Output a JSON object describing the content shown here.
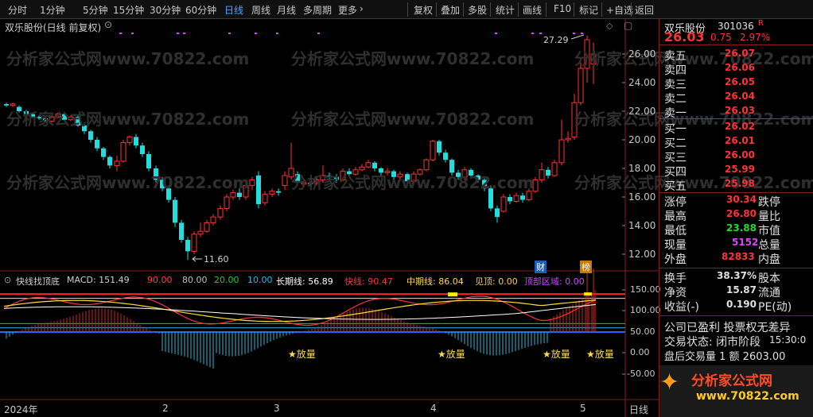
{
  "toolbar": {
    "left": [
      "分时",
      "1分钟",
      "5分钟",
      "15分钟",
      "30分钟",
      "60分钟",
      "日线",
      "周线",
      "月线",
      "多周期",
      "更多"
    ],
    "right": [
      "复权",
      "叠加",
      "多股",
      "统计",
      "画线",
      "F10",
      "标记",
      "+自选",
      "返回"
    ],
    "active": "日线"
  },
  "chart": {
    "title": "双乐股份(日线 前复权)",
    "watermark": "分析家公式网www.70822.com",
    "price_axis": [
      "26.00",
      "24.00",
      "22.00",
      "20.00",
      "18.00",
      "16.00",
      "14.00",
      "12.00"
    ],
    "high_label": "27.29",
    "low_label": "11.60",
    "badges": [
      "财",
      "榜"
    ],
    "date_axis": [
      "2024年",
      "2",
      "3",
      "4",
      "5"
    ],
    "date_right": "日线"
  },
  "indicator": {
    "name": "快线找顶底",
    "macd": "MACD: 151.49",
    "vals": [
      "90.00",
      "80.00",
      "20.00",
      "10.00"
    ],
    "long": "长期线: 56.89",
    "fast": "快线: 90.47",
    "mid": "中期线: 86.04",
    "top": "见顶: 0.00",
    "zone": "顶部区域: 0.00",
    "axis": [
      "150.00",
      "100.00",
      "50.00",
      "0.00",
      "-50.00"
    ],
    "signal": "放量"
  },
  "panel": {
    "name": "双乐股份",
    "code": "301036",
    "tag": "R",
    "price": "26.03",
    "change": "0.75",
    "pct": "2.97%",
    "sell": [
      {
        "label": "卖五",
        "price": "26.07"
      },
      {
        "label": "卖四",
        "price": "26.06"
      },
      {
        "label": "卖三",
        "price": "26.05"
      },
      {
        "label": "卖二",
        "price": "26.04"
      },
      {
        "label": "卖一",
        "price": "26.03"
      }
    ],
    "buy": [
      {
        "label": "买一",
        "price": "26.02"
      },
      {
        "label": "买二",
        "price": "26.01"
      },
      {
        "label": "买三",
        "price": "26.00"
      },
      {
        "label": "买四",
        "price": "25.99"
      },
      {
        "label": "买五",
        "price": "25.98"
      }
    ],
    "stats": [
      {
        "label": "涨停",
        "value": "30.34",
        "label2": "跌停",
        "color": "red"
      },
      {
        "label": "最高",
        "value": "26.80",
        "label2": "量比",
        "color": "red"
      },
      {
        "label": "最低",
        "value": "23.88",
        "label2": "市值",
        "color": "green"
      },
      {
        "label": "现量",
        "value": "5152",
        "label2": "总量",
        "color": "magenta"
      },
      {
        "label": "外盘",
        "value": "82833",
        "label2": "内盘",
        "color": "red"
      }
    ],
    "stats2": [
      {
        "label": "换手",
        "value": "38.37%",
        "label2": "股本"
      },
      {
        "label": "净资",
        "value": "15.87",
        "label2": "流通"
      },
      {
        "label": "收益(-)",
        "value": "0.190",
        "label2": "PE(动)"
      }
    ],
    "info": [
      "公司已盈利 投票权无差异",
      "交易状态: 闭市阶段",
      "15:30:0",
      "盘后交易量 1 额 2603.00"
    ],
    "logo": "分析家公式网",
    "logo_url": "www.70822.com"
  }
}
